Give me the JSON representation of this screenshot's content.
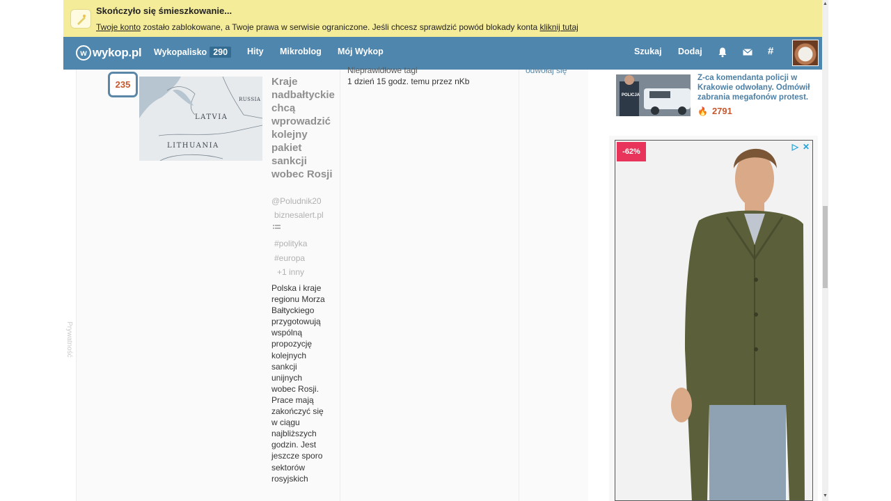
{
  "warning": {
    "title": "Skończyło się śmieszkowanie...",
    "link_account": "Twoje konto",
    "text_middle": " zostało zablokowane, a Twoje prawa w serwisie ograniczone. Jeśli chcesz sprawdzić powód blokady konta ",
    "link_here": "kliknij tutaj"
  },
  "nav": {
    "logo": "wykop.pl",
    "logo_mark": "w",
    "items": [
      {
        "label": "Wykopalisko",
        "badge": "290"
      },
      {
        "label": "Hity"
      },
      {
        "label": "Mikroblog"
      },
      {
        "label": "Mój Wykop"
      }
    ],
    "right": {
      "search": "Szukaj",
      "add": "Dodaj",
      "tag_icon": "#"
    }
  },
  "entry": {
    "votes": "235",
    "thumbnail_labels": {
      "latvia": "LATVIA",
      "lithuania": "LITHUANIA",
      "russia": "RUSSIA"
    },
    "title": "Kraje nadbałtyckie chcą wprowadzić kolejny pakiet sankcji wobec Rosji",
    "author": "@Poludnik20",
    "source": "biznesalert.pl",
    "tags": [
      "#polityka",
      "#europa"
    ],
    "more_tags": "+1 inny",
    "description": "Polska i kraje regionu Morza Bałtyckiego przygotowują wspólną propozycję kolejnych sankcji unijnych wobec Rosji. Prace mają zakończyć się w ciągu najbliższych godzin. Jest jeszcze sporo sektorów rosyjskich",
    "report_reason": "Nieprawidłowe tagi",
    "report_time": "1 dzień 15 godz. temu przez nKb",
    "undo_link": "odwołaj się"
  },
  "sidebar": {
    "news": {
      "title": "Z-ca komendanta policji w Krakowie odwołany. Odmówił zabrania megafonów protest.",
      "score": "2791",
      "badge_text": "POLICJA"
    },
    "ad": {
      "discount": "-62%",
      "ad_choices": "▷",
      "close": "✕"
    }
  },
  "privacy_label": "Prywatność",
  "colors": {
    "nav": "#4f86ad",
    "warning": "#f5ec9a",
    "accent": "#c4582f",
    "link": "#4b7fa5"
  }
}
